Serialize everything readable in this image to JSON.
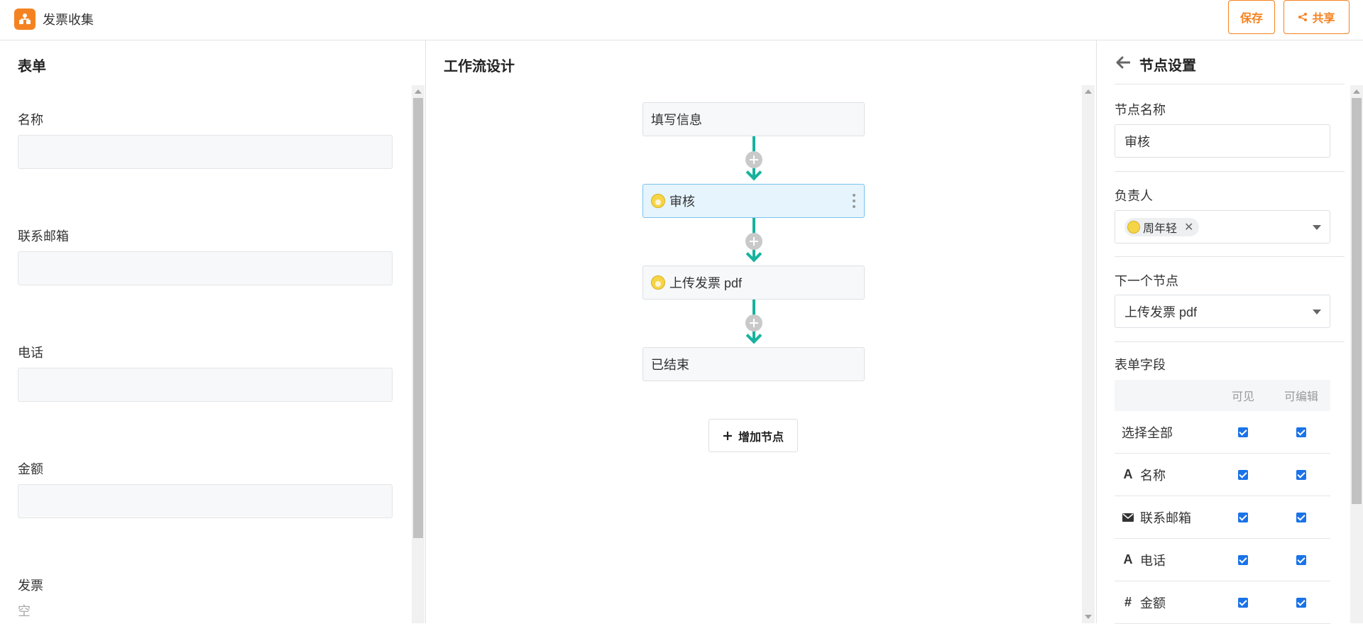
{
  "app": {
    "title": "发票收集",
    "icon": "org-chart-icon"
  },
  "header": {
    "save_label": "保存",
    "share_label": "共享"
  },
  "form_panel": {
    "title": "表单",
    "fields": [
      {
        "label": "名称",
        "value": ""
      },
      {
        "label": "联系邮箱",
        "value": ""
      },
      {
        "label": "电话",
        "value": ""
      },
      {
        "label": "金额",
        "value": ""
      }
    ],
    "attachment": {
      "label": "发票",
      "empty_text": "空"
    }
  },
  "workflow_panel": {
    "title": "工作流设计",
    "nodes": [
      {
        "label": "填写信息",
        "has_avatar": false,
        "active": false
      },
      {
        "label": "审核",
        "has_avatar": true,
        "active": true
      },
      {
        "label": "上传发票 pdf",
        "has_avatar": true,
        "active": false
      },
      {
        "label": "已结束",
        "has_avatar": false,
        "active": false
      }
    ],
    "add_node_label": "增加节点"
  },
  "node_settings": {
    "title": "节点设置",
    "name_label": "节点名称",
    "name_value": "审核",
    "assignee_label": "负责人",
    "assignee": "周年轻",
    "next_node_label": "下一个节点",
    "next_node_value": "上传发票 pdf",
    "fields_label": "表单字段",
    "columns": {
      "visible": "可见",
      "editable": "可编辑"
    },
    "rows": [
      {
        "name": "选择全部",
        "icon": "",
        "visible": true,
        "editable": true
      },
      {
        "name": "名称",
        "icon": "text-icon",
        "visible": true,
        "editable": true
      },
      {
        "name": "联系邮箱",
        "icon": "envelope-icon",
        "visible": true,
        "editable": true
      },
      {
        "name": "电话",
        "icon": "text-icon",
        "visible": true,
        "editable": true
      },
      {
        "name": "金额",
        "icon": "hash-icon",
        "visible": true,
        "editable": true
      }
    ]
  },
  "colors": {
    "accent": "#f58220",
    "flow": "#18b29e",
    "checkbox": "#1a73e8",
    "active_node_bg": "#e5f4fd"
  }
}
